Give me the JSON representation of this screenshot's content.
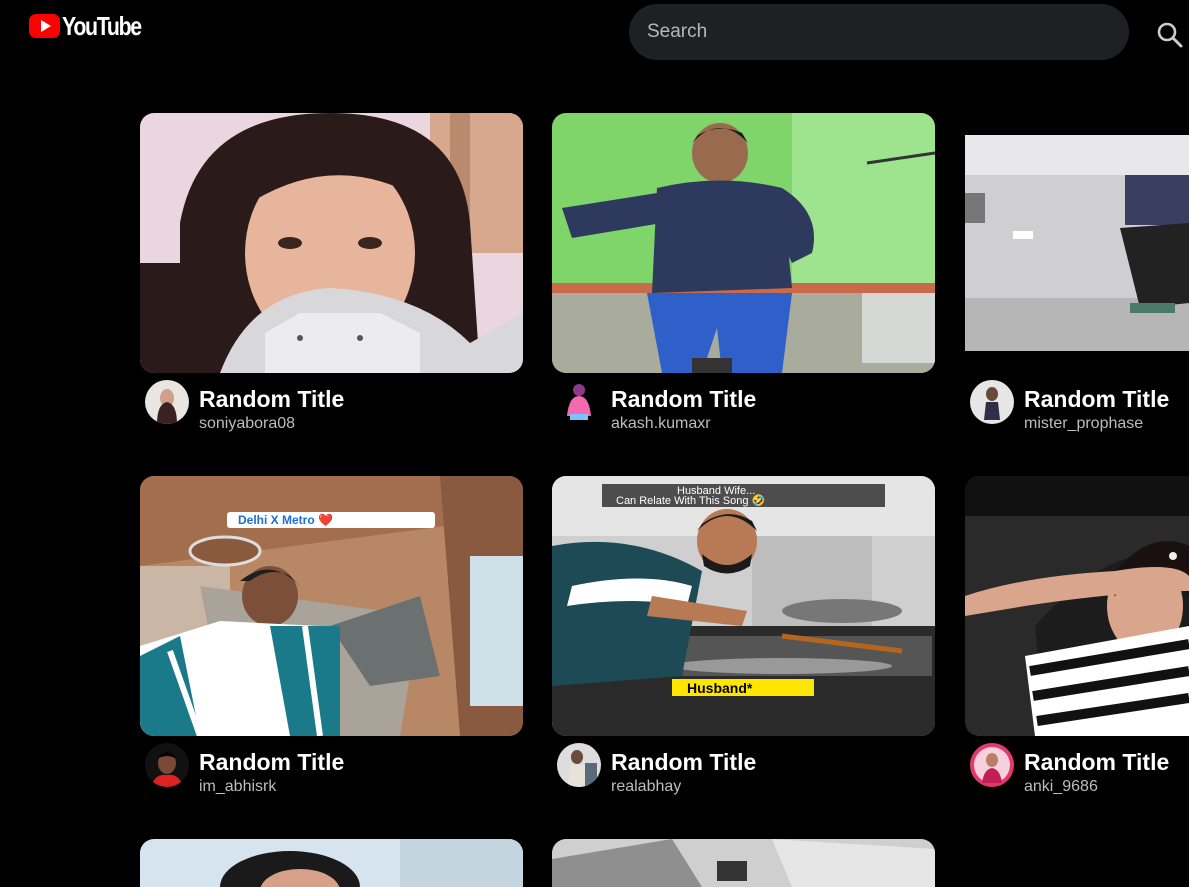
{
  "header": {
    "logo_text": "YouTube",
    "search_placeholder": "Search",
    "search_icon": "search-icon"
  },
  "videos": [
    {
      "title": "Random Title",
      "channel": "soniyabora08"
    },
    {
      "title": "Random Title",
      "channel": "akash.kumaxr"
    },
    {
      "title": "Random Title",
      "channel": "mister_prophase"
    },
    {
      "title": "Random Title",
      "channel": "im_abhisrk",
      "overlay": "Delhi X Metro ❤️"
    },
    {
      "title": "Random Title",
      "channel": "realabhay",
      "overlay_top_line1": "Husband Wife...",
      "overlay_top_line2": "Can Relate With This Song 🤣",
      "overlay_bottom": "Husband*"
    },
    {
      "title": "Random Title",
      "channel": "anki_9686"
    }
  ],
  "colors": {
    "brand_red": "#ff0000",
    "background": "#000000",
    "search_bg": "#1f2022"
  }
}
